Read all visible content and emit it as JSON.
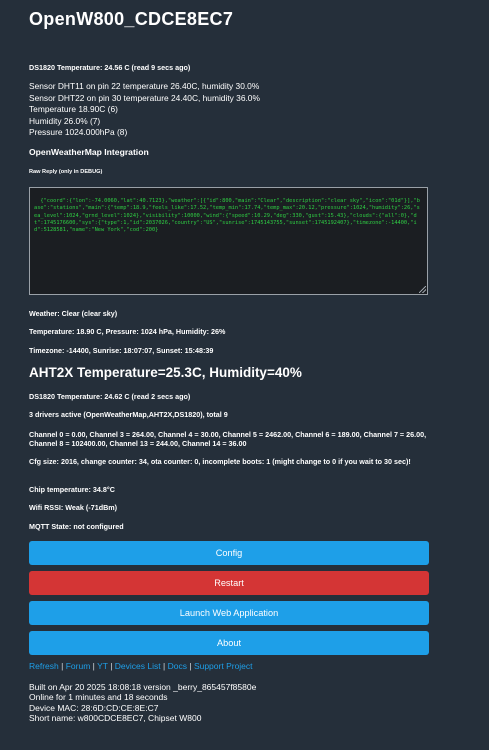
{
  "title": "OpenW800_CDCE8EC7",
  "ds1820_top": "DS1820 Temperature: 24.56 C (read 9 secs ago)",
  "sensors": [
    "Sensor DHT11 on pin 22 temperature 26.40C, humidity 30.0%",
    "Sensor DHT22 on pin 30 temperature 24.40C, humidity 36.0%",
    "Temperature 18.90C (6)",
    "Humidity 26.0% (7)",
    "Pressure 1024.000hPa (8)"
  ],
  "owm": {
    "heading": "OpenWeatherMap Integration",
    "raw_label": "Raw Reply (only in DEBUG)",
    "raw_reply": "{\"coord\":{\"lon\":-74.0060,\"lat\":40.7123},\"weather\":[{\"id\":800,\"main\":\"Clear\",\"description\":\"clear sky\",\"icon\":\"01d\"}],\"base\":\"stations\",\"main\":{\"temp\":18.9,\"feels_like\":17.52,\"temp_min\":17.74,\"temp_max\":20.12,\"pressure\":1024,\"humidity\":26,\"sea_level\":1024,\"grnd_level\":1024},\"visibility\":10000,\"wind\":{\"speed\":10.29,\"deg\":330,\"gust\":15.43},\"clouds\":{\"all\":0},\"dt\":1745176600,\"sys\":{\"type\":1,\"id\":2037026,\"country\":\"US\",\"sunrise\":1745143755,\"sunset\":1745192407},\"timezone\":-14400,\"id\":5128581,\"name\":\"New York\",\"cod\":200}",
    "weather": "Weather: Clear (clear sky)",
    "temp_line": "Temperature: 18.90 C, Pressure: 1024 hPa, Humidity: 26%",
    "tz_line": "Timezone: -14400, Sunrise: 18:07:07, Sunset: 15:48:39"
  },
  "aht": "AHT2X Temperature=25.3C, Humidity=40%",
  "ds1820_bottom": "DS1820 Temperature: 24.62 C (read 2 secs ago)",
  "drivers": "3 drivers active (OpenWeatherMap,AHT2X,DS1820), total 9",
  "channels": "Channel 0 = 0.00, Channel 3 = 264.00, Channel 4 = 30.00, Channel 5 = 2462.00, Channel 6 = 189.00, Channel 7 = 26.00, Channel 8 = 102400.00, Channel 13 = 244.00, Channel 14 = 36.00",
  "cfg": "Cfg size: 2016, change counter: 34, ota counter: 0, incomplete boots: 1 (might change to 0 if you wait to 30 sec)!",
  "chip_temp": "Chip temperature: 34.8°C",
  "wifi": "Wifi RSSI: Weak (-71dBm)",
  "mqtt": "MQTT State: not configured",
  "buttons": {
    "config": "Config",
    "restart": "Restart",
    "launch": "Launch Web Application",
    "about": "About"
  },
  "links": [
    "Refresh",
    "Forum",
    "YT",
    "Devices List",
    "Docs",
    "Support Project"
  ],
  "link_sep": "|",
  "footer": [
    "Built on Apr 20 2025 18:08:18 version _berry_865457f8580e",
    "Online for 1 minutes and 18 seconds",
    "Device MAC: 28:6D:CD:CE:8E:C7",
    "Short name: w800CDCE8EC7, Chipset W800"
  ],
  "colors": {
    "background": "#252f3a",
    "button_blue": "#1e9fe8",
    "button_red": "#d43535",
    "raw_text": "#2fce44"
  }
}
